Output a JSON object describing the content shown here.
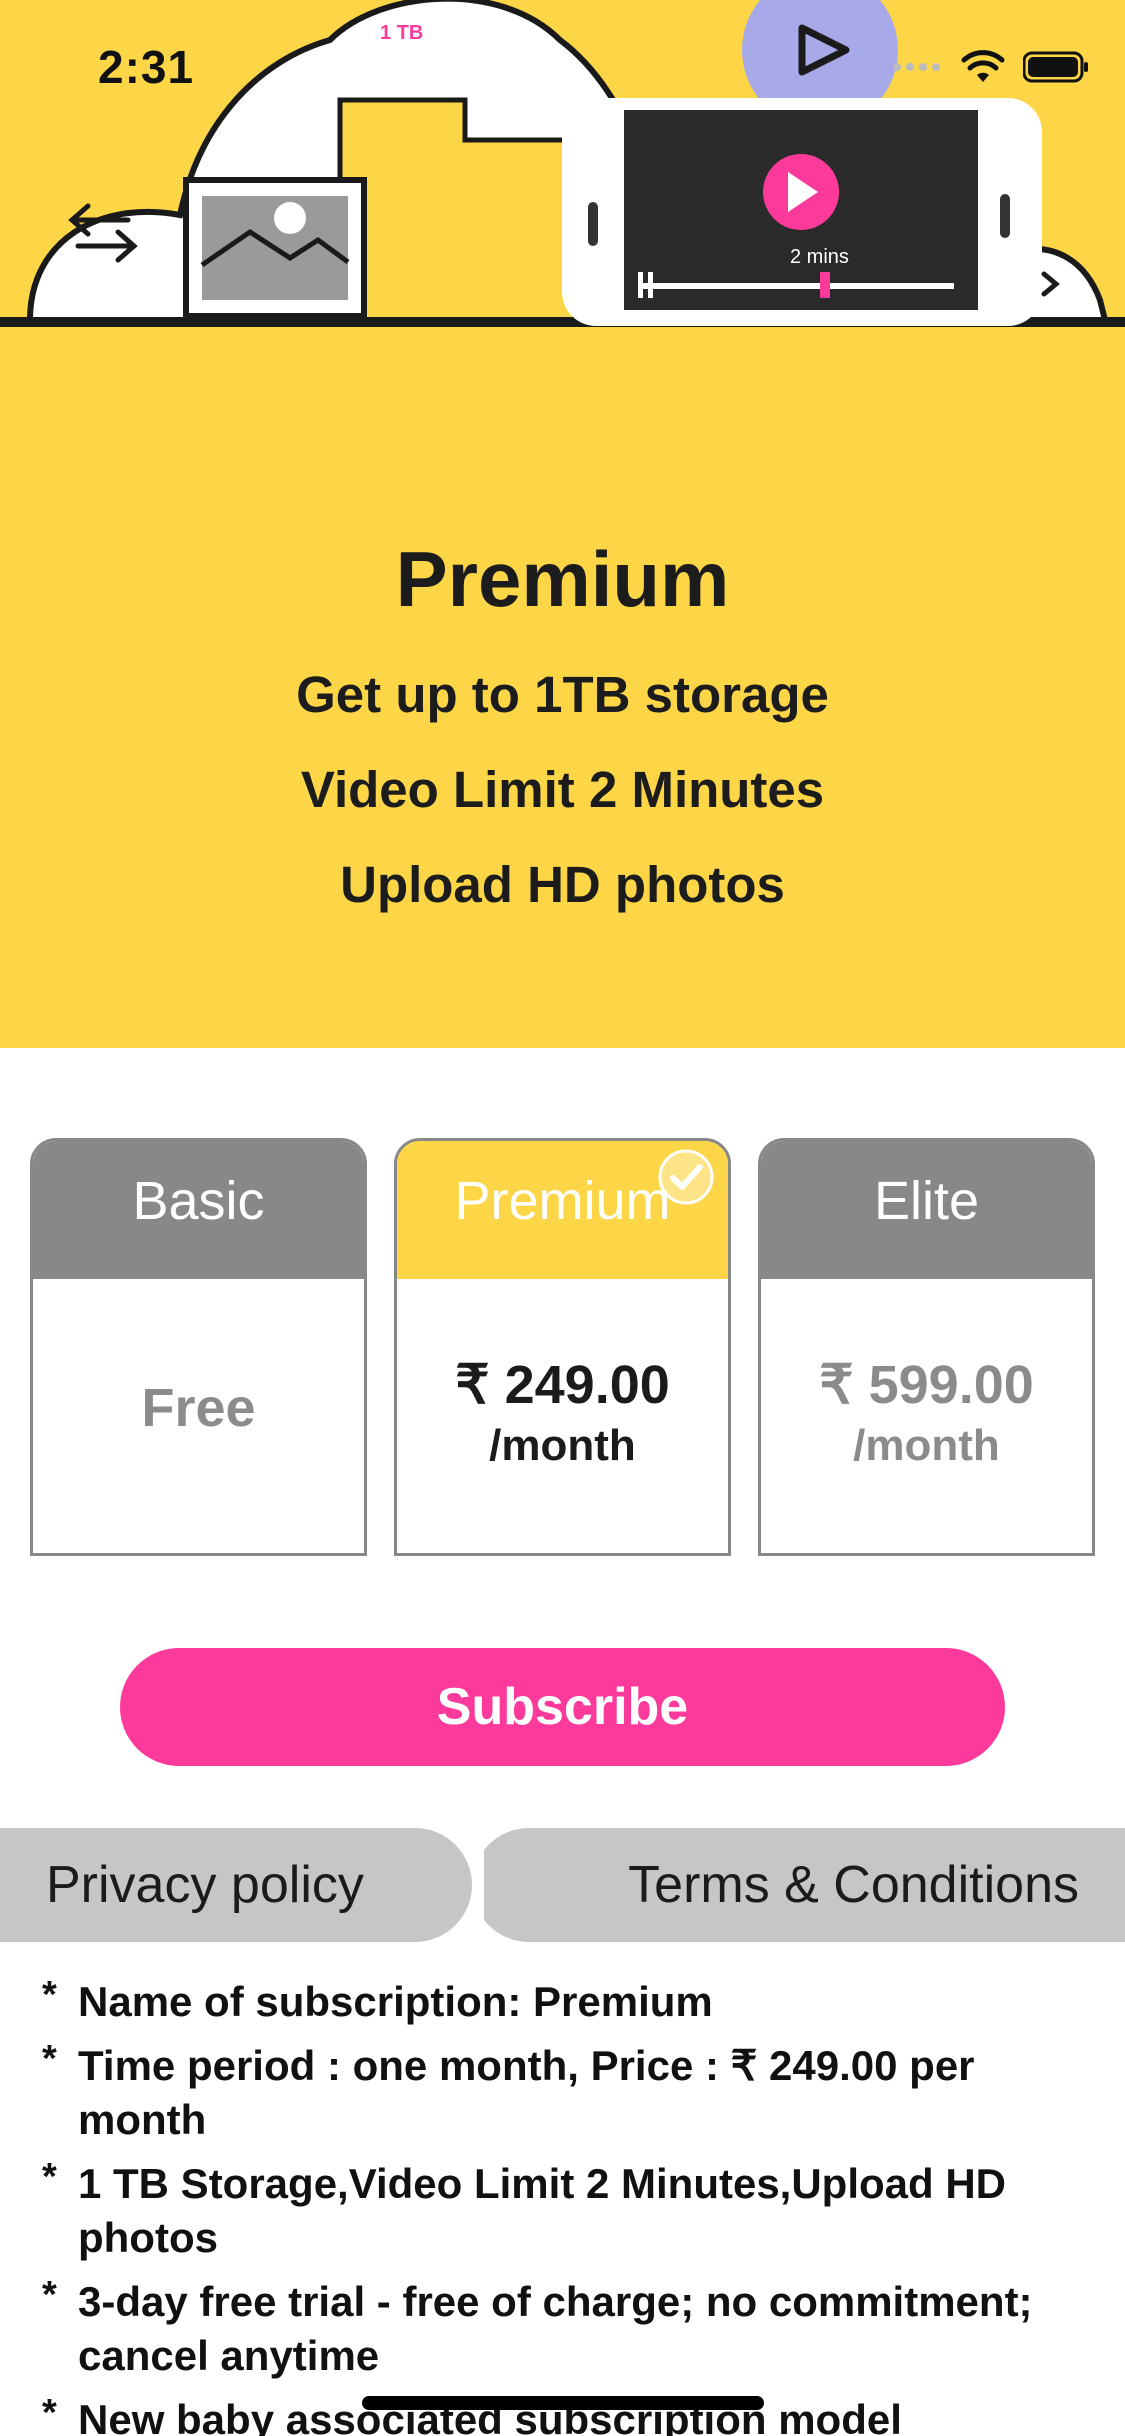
{
  "status_bar": {
    "time": "2:31"
  },
  "hero": {
    "illustration_storage_label": "1 TB",
    "illustration_video_label": "2 mins",
    "title": "Premium",
    "features": [
      "Get up to 1TB storage",
      "Video Limit 2 Minutes",
      "Upload HD photos"
    ]
  },
  "plans": [
    {
      "name": "Basic",
      "price": "Free",
      "period": "",
      "selected": false
    },
    {
      "name": "Premium",
      "price": "₹ 249.00",
      "period": "/month",
      "selected": true
    },
    {
      "name": "Elite",
      "price": "₹ 599.00",
      "period": "/month",
      "selected": false
    }
  ],
  "subscribe_label": "Subscribe",
  "links": {
    "privacy": "Privacy policy",
    "terms": "Terms & Conditions"
  },
  "notes": [
    "Name of subscription: Premium",
    "Time period : one month, Price : ₹ 249.00 per month",
    "1 TB Storage,Video Limit 2 Minutes,Upload HD photos",
    "3-day free trial - free of charge; no commitment; cancel anytime",
    "New baby associated subscription model"
  ],
  "colors": {
    "brand_yellow": "#fcd647",
    "accent_pink": "#fc3a9b",
    "inactive_gray": "#888888",
    "tab_gray": "#c6c6c6"
  },
  "icons": [
    "wifi-icon",
    "battery-icon",
    "signal-icon",
    "play-icon",
    "transfer-arrows-icon",
    "photo-icon",
    "checkmark-icon"
  ]
}
